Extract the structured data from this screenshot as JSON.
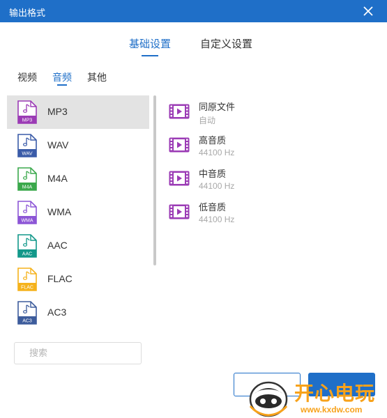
{
  "window": {
    "title": "输出格式"
  },
  "top_tabs": [
    {
      "label": "基础设置",
      "active": true
    },
    {
      "label": "自定义设置",
      "active": false
    }
  ],
  "sub_tabs": [
    {
      "label": "视频",
      "active": false
    },
    {
      "label": "音频",
      "active": true
    },
    {
      "label": "其他",
      "active": false
    }
  ],
  "formats": [
    {
      "name": "MP3",
      "badge": "MP3",
      "color": "#9b3bb5",
      "selected": true
    },
    {
      "name": "WAV",
      "badge": "WAV",
      "color": "#3a5ba8",
      "selected": false
    },
    {
      "name": "M4A",
      "badge": "M4A",
      "color": "#3aa84b",
      "selected": false
    },
    {
      "name": "WMA",
      "badge": "WMA",
      "color": "#8c55d6",
      "selected": false
    },
    {
      "name": "AAC",
      "badge": "AAC",
      "color": "#12988a",
      "selected": false
    },
    {
      "name": "FLAC",
      "badge": "FLAC",
      "color": "#f5b21b",
      "selected": false
    },
    {
      "name": "AC3",
      "badge": "AC3",
      "color": "#3d5c9c",
      "selected": false
    }
  ],
  "qualities": [
    {
      "name": "同原文件",
      "desc": "自动"
    },
    {
      "name": "高音质",
      "desc": "44100 Hz"
    },
    {
      "name": "中音质",
      "desc": "44100 Hz"
    },
    {
      "name": "低音质",
      "desc": "44100 Hz"
    }
  ],
  "search": {
    "placeholder": "搜索",
    "value": ""
  },
  "watermark": {
    "text": "开心电玩",
    "url": "www.kxdw.com"
  },
  "colors": {
    "accent": "#1f6fc8",
    "quality_icon": "#9b3bb5",
    "watermark": "#f7a21b"
  },
  "icons": {
    "close": "close-icon",
    "format": "music-file-icon",
    "quality": "video-film-icon",
    "watermark": "mascot-logo-icon"
  }
}
